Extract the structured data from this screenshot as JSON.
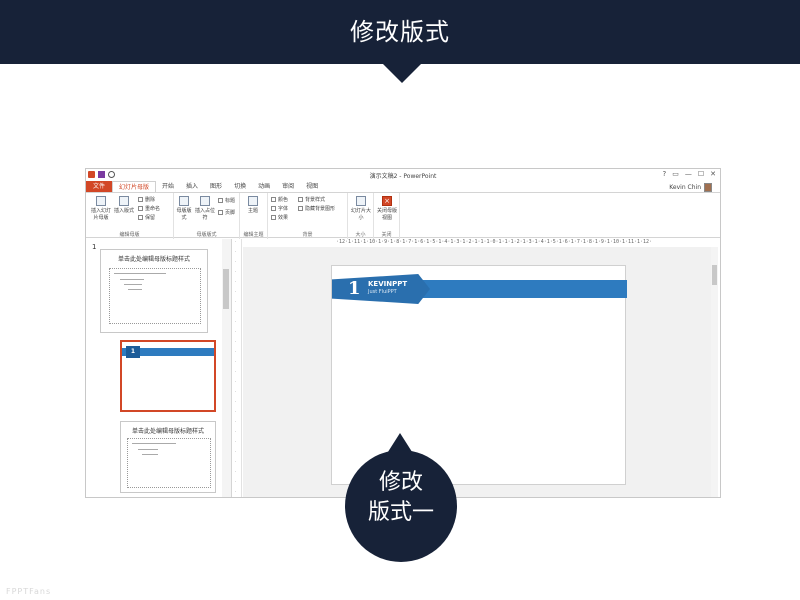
{
  "banner": {
    "title": "修改版式"
  },
  "app": {
    "doc_title": "演示文稿2 - PowerPoint",
    "window_controls": [
      "?",
      "▭",
      "—",
      "☐",
      "✕"
    ],
    "user_name": "Kevin Chin",
    "tabs": [
      "文件",
      "幻灯片母版",
      "开始",
      "插入",
      "图形",
      "切换",
      "动画",
      "审阅",
      "视图"
    ]
  },
  "ribbon": {
    "group1": {
      "label": "编辑母版",
      "insert_master": "插入幻灯片母版",
      "insert_layout": "插入版式",
      "delete": "删除",
      "rename": "重命名",
      "preserve": "保留"
    },
    "group2": {
      "label": "母版版式",
      "master_layout": "母版版式",
      "insert_placeholder": "插入占位符",
      "title": "标题",
      "footer": "页脚"
    },
    "group3": {
      "label": "编辑主题",
      "themes": "主题"
    },
    "group4": {
      "label": "背景",
      "colors": "颜色",
      "fonts": "字体",
      "effects": "效果",
      "bg_styles": "背景样式",
      "hide_bg": "隐藏背景图形"
    },
    "group5": {
      "label": "大小",
      "slide_size": "幻灯片大小"
    },
    "group6": {
      "label": "关闭",
      "close_master": "关闭母版视图"
    }
  },
  "thumbnails": {
    "slide_number": "1",
    "thumb1_title": "单击此处编辑母版标题样式",
    "thumb3_title": "单击此处编辑母版标题样式",
    "mini_number": "1"
  },
  "ruler": {
    "horizontal": "·12·1·11·1·10·1·9·1·8·1·7·1·6·1·5·1·4·1·3·1·2·1·1·1·0·1·1·1·2·1·3·1·4·1·5·1·6·1·7·1·8·1·9·1·10·1·11·1·12·"
  },
  "slide": {
    "number": "1",
    "name": "KEVINPPT",
    "subtitle": "Just FluiPPT"
  },
  "bubble": {
    "line1": "修改",
    "line2": "版式一"
  },
  "watermark": "FPPTFans",
  "colors": {
    "banner": "#172238",
    "accent": "#d24726",
    "slide_band": "#2e7bbf"
  }
}
